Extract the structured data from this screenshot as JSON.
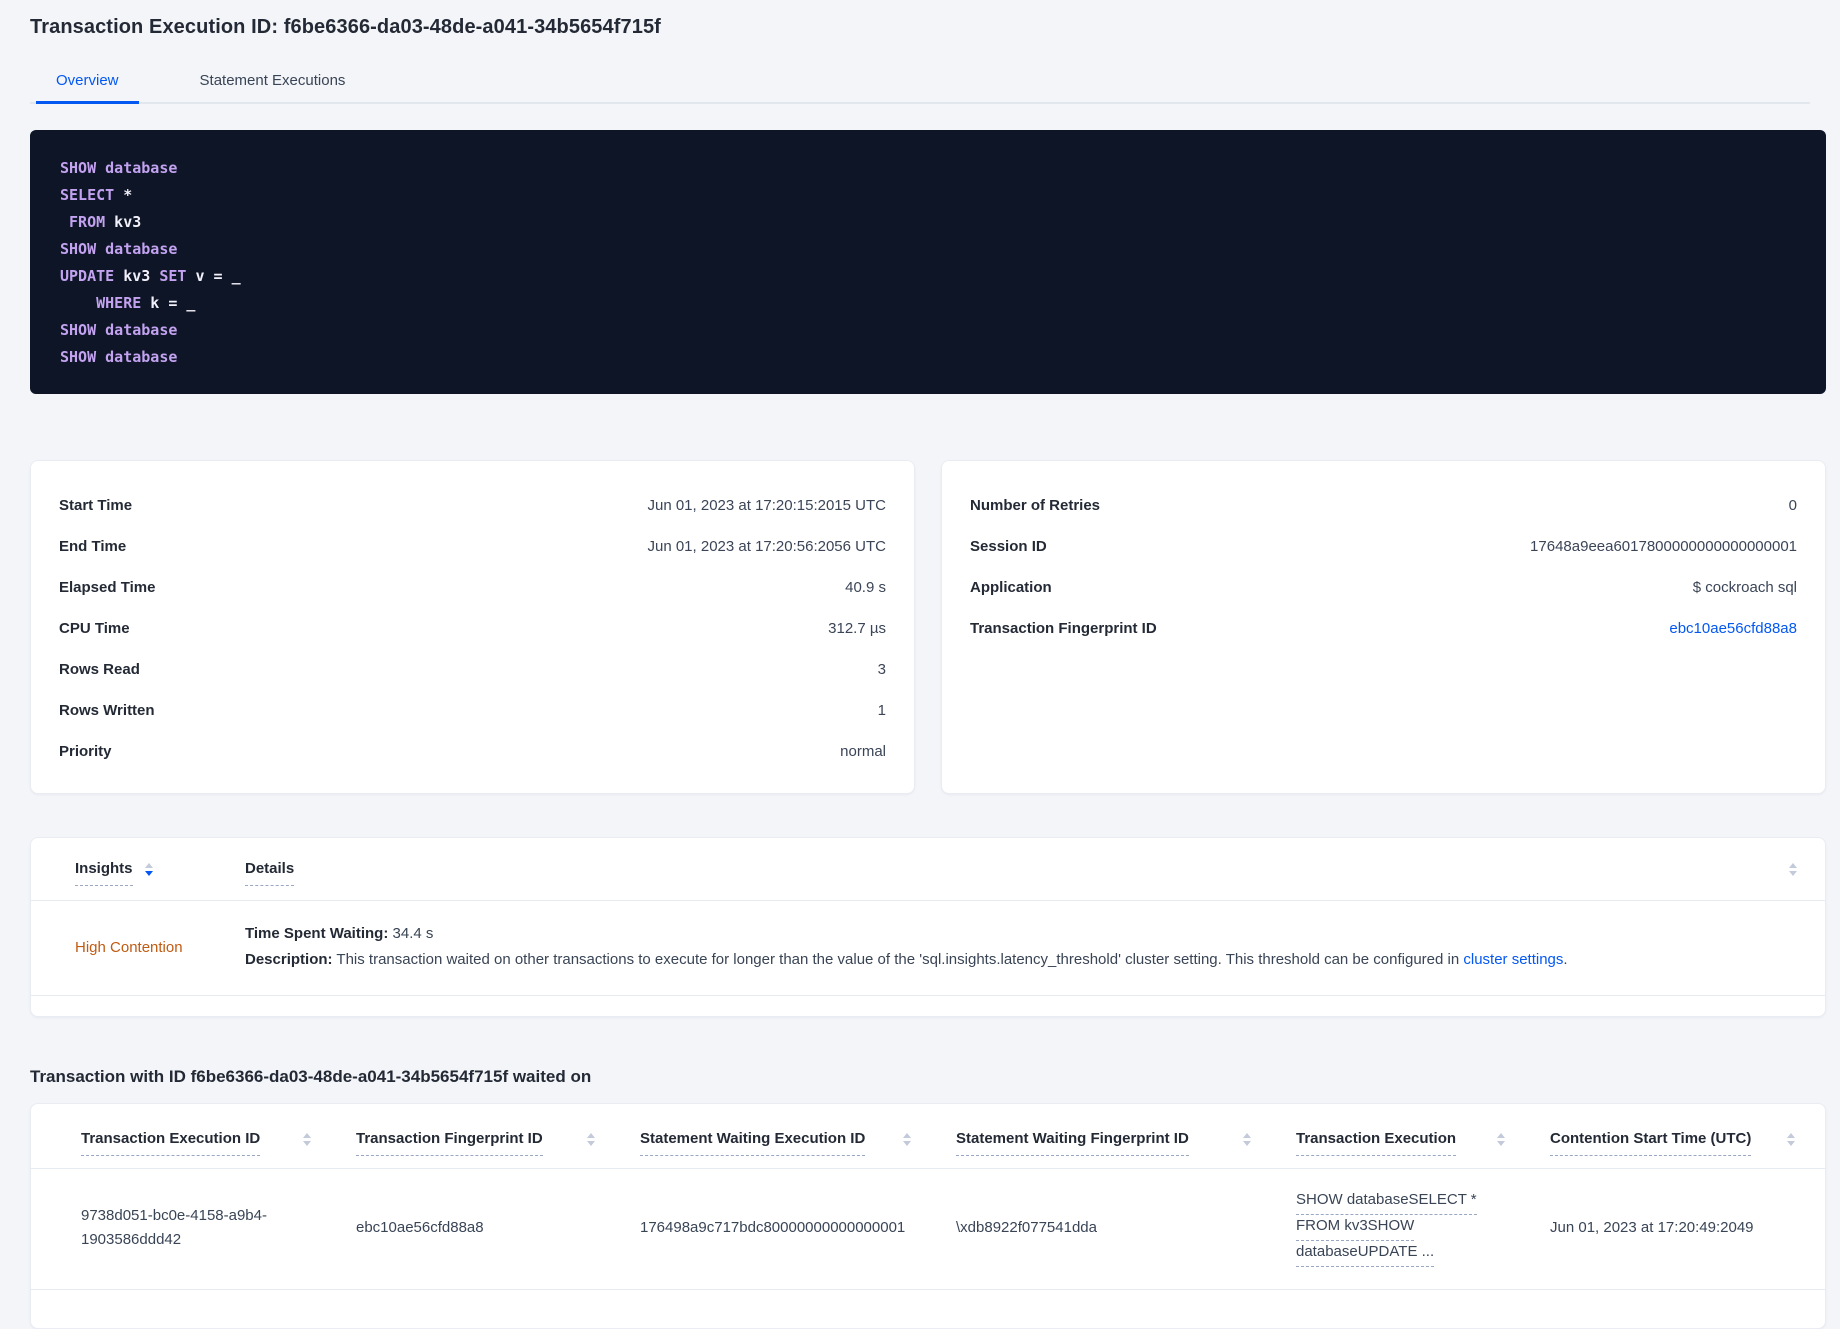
{
  "colors": {
    "accent": "#0458f2",
    "warning": "#c05b12",
    "code_keyword": "#c3a2f0",
    "code_background": "#0d1526"
  },
  "page": {
    "title": "Transaction Execution ID: f6be6366-da03-48de-a041-34b5654f715f"
  },
  "tabs": [
    {
      "label": "Overview"
    },
    {
      "label": "Statement Executions"
    }
  ],
  "sql": {
    "lines": [
      [
        {
          "t": "kw",
          "v": "SHOW"
        },
        {
          "t": "tx",
          "v": " "
        },
        {
          "t": "kw",
          "v": "database"
        }
      ],
      [
        {
          "t": "kw",
          "v": "SELECT"
        },
        {
          "t": "tx",
          "v": " *"
        }
      ],
      [
        {
          "t": "tx",
          "v": " "
        },
        {
          "t": "kw",
          "v": "FROM"
        },
        {
          "t": "tx",
          "v": " kv3"
        }
      ],
      [
        {
          "t": "kw",
          "v": "SHOW"
        },
        {
          "t": "tx",
          "v": " "
        },
        {
          "t": "kw",
          "v": "database"
        }
      ],
      [
        {
          "t": "kw",
          "v": "UPDATE"
        },
        {
          "t": "tx",
          "v": " kv3 "
        },
        {
          "t": "kw",
          "v": "SET"
        },
        {
          "t": "tx",
          "v": " v = _"
        }
      ],
      [
        {
          "t": "tx",
          "v": "    "
        },
        {
          "t": "kw",
          "v": "WHERE"
        },
        {
          "t": "tx",
          "v": " k = _"
        }
      ],
      [
        {
          "t": "kw",
          "v": "SHOW"
        },
        {
          "t": "tx",
          "v": " "
        },
        {
          "t": "kw",
          "v": "database"
        }
      ],
      [
        {
          "t": "kw",
          "v": "SHOW"
        },
        {
          "t": "tx",
          "v": " "
        },
        {
          "t": "kw",
          "v": "database"
        }
      ]
    ]
  },
  "cards": {
    "left": {
      "rows": [
        {
          "label": "Start Time",
          "value": "Jun 01, 2023 at 17:20:15:2015 UTC"
        },
        {
          "label": "End Time",
          "value": "Jun 01, 2023 at 17:20:56:2056 UTC"
        },
        {
          "label": "Elapsed Time",
          "value": "40.9 s"
        },
        {
          "label": "CPU Time",
          "value": "312.7 µs"
        },
        {
          "label": "Rows Read",
          "value": "3"
        },
        {
          "label": "Rows Written",
          "value": "1"
        },
        {
          "label": "Priority",
          "value": "normal"
        }
      ]
    },
    "right": {
      "rows": [
        {
          "label": "Number of Retries",
          "value": "0"
        },
        {
          "label": "Session ID",
          "value": "17648a9eea6017800000000000000001"
        },
        {
          "label": "Application",
          "value": "$ cockroach sql"
        },
        {
          "label": "Transaction Fingerprint ID",
          "value": "ebc10ae56cfd88a8"
        }
      ]
    }
  },
  "insights": {
    "col_insights": "Insights",
    "col_details": "Details",
    "row": {
      "severity": "High Contention",
      "wait_label": "Time Spent Waiting:",
      "wait_value": " 34.4 s",
      "desc_label": "Description:",
      "desc_text": " This transaction waited on other transactions to execute for longer than the value of the 'sql.insights.latency_threshold' cluster setting. This threshold can be configured in ",
      "desc_link": "cluster settings",
      "desc_after": "."
    }
  },
  "waited_on": {
    "heading": "Transaction with ID f6be6366-da03-48de-a041-34b5654f715f waited on",
    "columns": [
      "Transaction Execution ID",
      "Transaction Fingerprint ID",
      "Statement Waiting Execution ID",
      "Statement Waiting Fingerprint ID",
      "Transaction Execution",
      "Contention Start Time (UTC)"
    ],
    "row": {
      "txn_execution_id": "9738d051-bc0e-4158-a9b4-1903586ddd42",
      "txn_fingerprint_id": "ebc10ae56cfd88a8",
      "stmt_waiting_execution_id": "176498a9c717bdc80000000000000001",
      "stmt_waiting_fingerprint_id": "\\xdb8922f077541dda",
      "txn_execution_lines": [
        "SHOW databaseSELECT *",
        "FROM kv3SHOW",
        "databaseUPDATE ..."
      ],
      "contention_start": "Jun 01, 2023 at 17:20:49:2049"
    }
  }
}
